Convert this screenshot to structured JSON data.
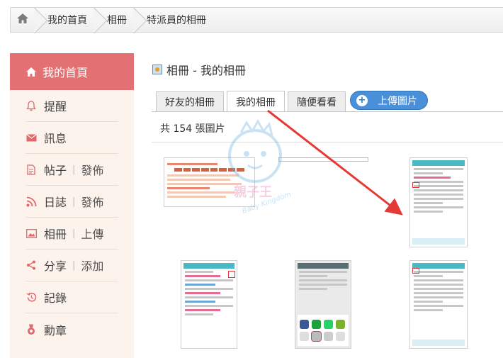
{
  "breadcrumb": {
    "items": [
      "我的首頁",
      "相冊",
      "特派員的相冊"
    ]
  },
  "sidebar": {
    "active": {
      "label": "我的首頁",
      "icon": "home-icon"
    },
    "items": [
      {
        "label": "提醒",
        "icon": "bell-icon"
      },
      {
        "label": "訊息",
        "icon": "mail-icon"
      },
      {
        "label": "帖子",
        "sub": "發佈",
        "icon": "document-icon"
      },
      {
        "label": "日誌",
        "sub": "發佈",
        "icon": "feed-icon"
      },
      {
        "label": "相冊",
        "sub": "上傳",
        "icon": "picture-icon"
      },
      {
        "label": "分享",
        "sub": "添加",
        "icon": "share-icon"
      },
      {
        "label": "記錄",
        "icon": "history-icon"
      },
      {
        "label": "勳章",
        "icon": "medal-icon"
      }
    ]
  },
  "main": {
    "title": "相冊 - 我的相冊",
    "tabs": [
      "好友的相冊",
      "我的相冊",
      "隨便看看"
    ],
    "active_tab": "我的相冊",
    "upload_label": "上傳圖片",
    "count_text": "共 154 張圖片"
  },
  "watermark": {
    "name": "親子王",
    "sub": "Baby Kingdom"
  },
  "colors": {
    "accent": "#e37173",
    "sidebar_bg": "#fdf3ed",
    "upload": "#4a90d9",
    "arrow": "#e53935"
  }
}
